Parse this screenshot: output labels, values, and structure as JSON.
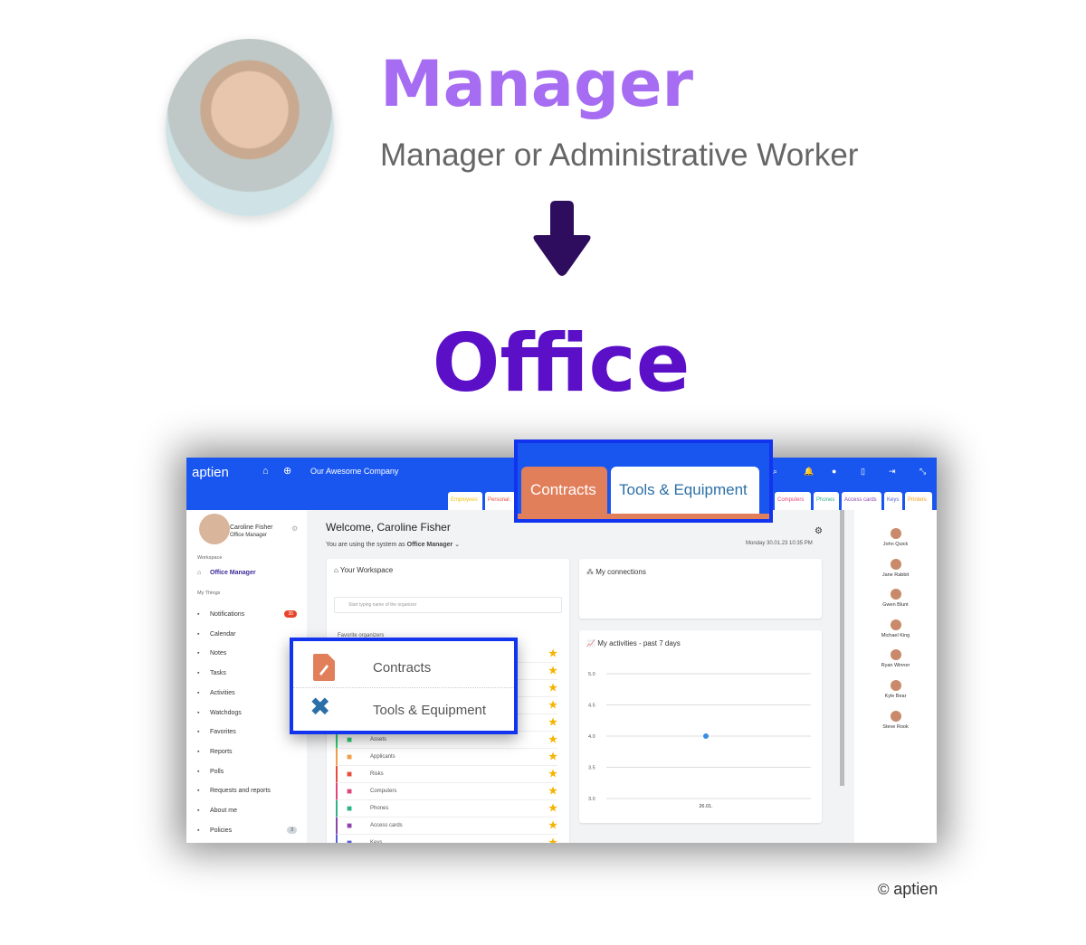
{
  "hero": {
    "title": "Manager",
    "subtitle": "Manager or Administrative Worker",
    "target": "Office"
  },
  "app": {
    "logo": "aptien",
    "company": "Our Awesome Company",
    "tabs_left": [
      "Employees",
      "Personal"
    ],
    "tabs_right": [
      {
        "label": "Computers",
        "color": "#e0457b"
      },
      {
        "label": "Phones",
        "color": "#2db38a"
      },
      {
        "label": "Access cards",
        "color": "#8e44ad"
      },
      {
        "label": "Keys",
        "color": "#5b5fd6"
      },
      {
        "label": "Printers",
        "color": "#f39c12"
      }
    ],
    "notif_badge": "35",
    "user": {
      "name": "Caroline Fisher",
      "role": "Office Manager"
    },
    "sidebar": {
      "workspace_label": "Workspace",
      "active": "Office Manager",
      "my_things_label": "My Things",
      "items": [
        {
          "label": "Notifications",
          "icon": "bell-icon",
          "badge": "35"
        },
        {
          "label": "Calendar",
          "icon": "calendar-icon"
        },
        {
          "label": "Notes",
          "icon": "clipboard-icon"
        },
        {
          "label": "Tasks",
          "icon": "clipboard-icon"
        },
        {
          "label": "Activities",
          "icon": "activity-icon"
        },
        {
          "label": "Watchdogs",
          "icon": "dog-icon"
        },
        {
          "label": "Favorites",
          "icon": "star-icon"
        },
        {
          "label": "Reports",
          "icon": "report-icon"
        },
        {
          "label": "Polls",
          "icon": "poll-icon"
        },
        {
          "label": "Requests and reports",
          "icon": "clipboard-icon"
        },
        {
          "label": "About me",
          "icon": "user-icon"
        },
        {
          "label": "Policies",
          "icon": "policy-icon",
          "badge": "3"
        }
      ]
    },
    "welcome": "Welcome, Caroline Fisher",
    "using_prefix": "You are using the system as",
    "using_role": "Office Manager",
    "datetime": "Monday 30.01.23 10:35 PM",
    "workspace": {
      "title": "Your Workspace",
      "search_placeholder": "Start typing name of the organizer",
      "favorites_label": "Favorite organizers",
      "rows": [
        {
          "label": "Assets",
          "color": "#2ecc71"
        },
        {
          "label": "Applicants",
          "color": "#f0a04b"
        },
        {
          "label": "Risks",
          "color": "#e74c3c"
        },
        {
          "label": "Computers",
          "color": "#e0457b"
        },
        {
          "label": "Phones",
          "color": "#2db38a"
        },
        {
          "label": "Access cards",
          "color": "#8e44ad"
        },
        {
          "label": "Keys",
          "color": "#5b5fd6"
        }
      ]
    },
    "connections": {
      "title": "My connections"
    },
    "activities": {
      "title": "My activities - past 7 days"
    },
    "people": [
      "John Quick",
      "Jane Rabbit",
      "Gwen Blunt",
      "Michael King",
      "Ryan Winner",
      "Kyle Bear",
      "Steve Rook"
    ]
  },
  "highlight_tabs": [
    "Contracts",
    "Tools & Equipment"
  ],
  "highlight_menu": [
    "Contracts",
    "Tools & Equipment"
  ],
  "copyright": {
    "symbol": "©",
    "logo": "aptien"
  },
  "chart_data": {
    "type": "scatter",
    "x": [
      "26.01."
    ],
    "values": [
      4.0
    ],
    "yticks": [
      "5.0",
      "4.5",
      "4.0",
      "3.5",
      "3.0"
    ],
    "ylim": [
      3.0,
      5.0
    ],
    "grid": true,
    "color": "#3b8de0"
  }
}
